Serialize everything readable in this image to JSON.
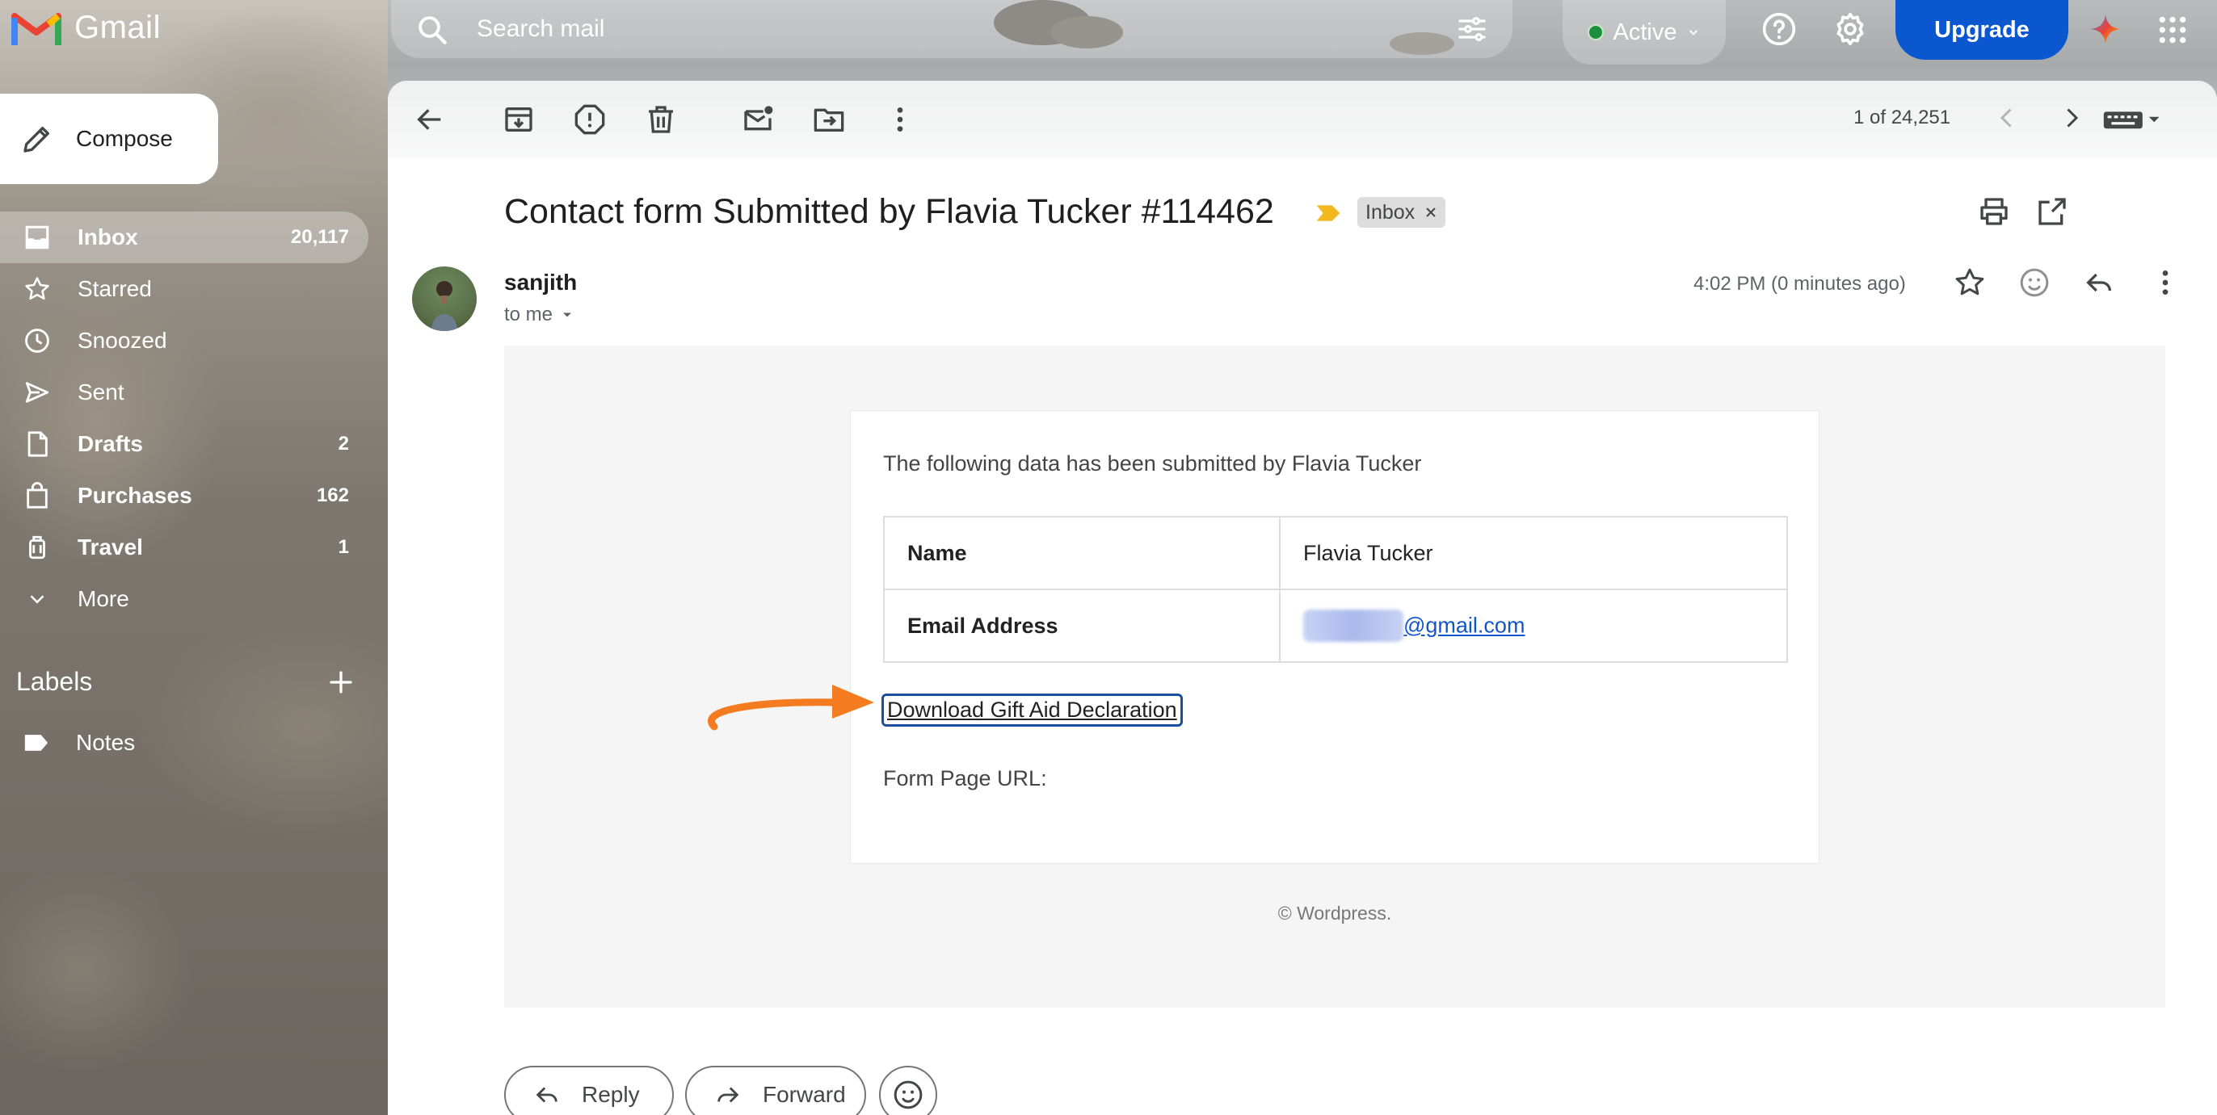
{
  "app": {
    "name": "Gmail"
  },
  "search": {
    "placeholder": "Search mail"
  },
  "status": {
    "label": "Active"
  },
  "header_actions": {
    "upgrade_label": "Upgrade"
  },
  "compose": {
    "label": "Compose"
  },
  "sidebar": {
    "items": [
      {
        "label": "Inbox",
        "count": "20,117",
        "icon": "inbox-icon"
      },
      {
        "label": "Starred",
        "count": "",
        "icon": "star-icon"
      },
      {
        "label": "Snoozed",
        "count": "",
        "icon": "clock-icon"
      },
      {
        "label": "Sent",
        "count": "",
        "icon": "send-icon"
      },
      {
        "label": "Drafts",
        "count": "2",
        "icon": "draft-icon"
      },
      {
        "label": "Purchases",
        "count": "162",
        "icon": "shopping-bag-icon"
      },
      {
        "label": "Travel",
        "count": "1",
        "icon": "luggage-icon"
      },
      {
        "label": "More",
        "count": "",
        "icon": "chevron-down-icon"
      }
    ],
    "labels_heading": "Labels",
    "labels": [
      {
        "label": "Notes",
        "icon": "label-icon"
      }
    ]
  },
  "toolbar": {
    "pager": "1 of 24,251"
  },
  "email": {
    "subject": "Contact form Submitted by Flavia Tucker #114462",
    "chip": "Inbox",
    "sender": "sanjith",
    "to": "to me",
    "time": "4:02 PM (0 minutes ago)",
    "intro": "The following data has been submitted by Flavia Tucker",
    "table": [
      {
        "key": "Name",
        "value": "Flavia Tucker"
      },
      {
        "key": "Email Address",
        "value": "@gmail.com"
      }
    ],
    "download_link": "Download Gift Aid Declaration",
    "form_url_label": "Form Page URL:",
    "footer": "© Wordpress."
  },
  "actions": {
    "reply": "Reply",
    "forward": "Forward"
  },
  "colors": {
    "brand_blue": "#0b57d0",
    "link": "#1155cc",
    "annotation": "#f47b20"
  }
}
